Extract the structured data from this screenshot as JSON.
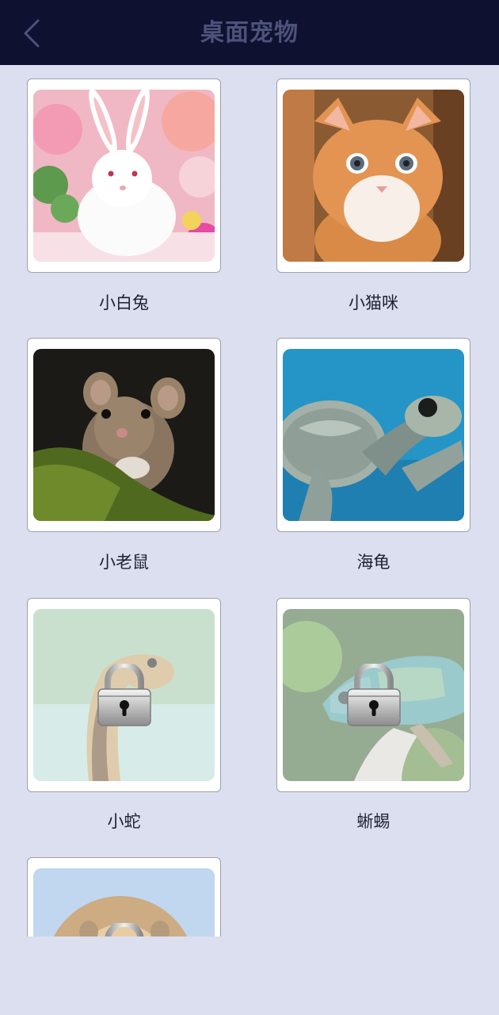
{
  "header": {
    "title": "桌面宠物",
    "back_icon": "chevron-left-icon"
  },
  "colors": {
    "header_bg": "#0e1130",
    "title_color": "#4d527a",
    "page_bg": "#dcdff0"
  },
  "pets": [
    {
      "name": "小白兔",
      "locked": false,
      "image": "white-rabbit-photo"
    },
    {
      "name": "小猫咪",
      "locked": false,
      "image": "orange-kitten-photo"
    },
    {
      "name": "小老鼠",
      "locked": false,
      "image": "mouse-photo"
    },
    {
      "name": "海龟",
      "locked": false,
      "image": "sea-turtle-photo"
    },
    {
      "name": "小蛇",
      "locked": true,
      "image": "snake-photo"
    },
    {
      "name": "蜥蜴",
      "locked": true,
      "image": "chameleon-photo"
    },
    {
      "name": "",
      "locked": true,
      "image": "lion-photo"
    }
  ]
}
